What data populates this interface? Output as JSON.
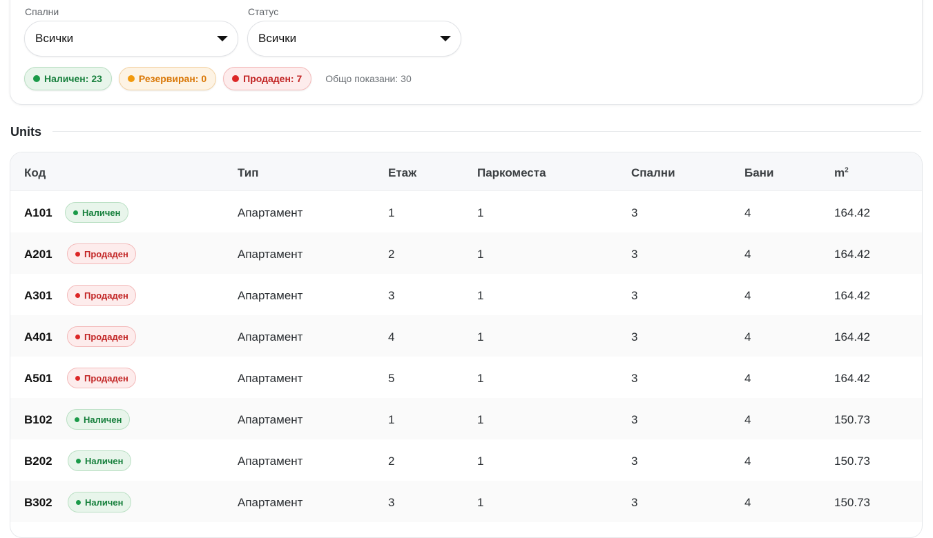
{
  "filters": {
    "bedrooms": {
      "label": "Спални",
      "value": "Всички"
    },
    "status": {
      "label": "Статус",
      "value": "Всички"
    }
  },
  "summary": {
    "available": "Наличен: 23",
    "reserved": "Резервиран: 0",
    "sold": "Продаден: 7",
    "total": "Общо показани: 30"
  },
  "section": {
    "title": "Units"
  },
  "table": {
    "headers": {
      "code": "Код",
      "type": "Тип",
      "floor": "Етаж",
      "parking": "Паркоместа",
      "bedrooms": "Спални",
      "bathrooms": "Бани",
      "area": "m",
      "area_sup": "2"
    },
    "rows": [
      {
        "code": "A101",
        "status": "Наличен",
        "type": "Апартамент",
        "floor": "1",
        "parking": "1",
        "bedrooms": "3",
        "bathrooms": "4",
        "area": "164.42"
      },
      {
        "code": "A201",
        "status": "Продаден",
        "type": "Апартамент",
        "floor": "2",
        "parking": "1",
        "bedrooms": "3",
        "bathrooms": "4",
        "area": "164.42"
      },
      {
        "code": "A301",
        "status": "Продаден",
        "type": "Апартамент",
        "floor": "3",
        "parking": "1",
        "bedrooms": "3",
        "bathrooms": "4",
        "area": "164.42"
      },
      {
        "code": "A401",
        "status": "Продаден",
        "type": "Апартамент",
        "floor": "4",
        "parking": "1",
        "bedrooms": "3",
        "bathrooms": "4",
        "area": "164.42"
      },
      {
        "code": "A501",
        "status": "Продаден",
        "type": "Апартамент",
        "floor": "5",
        "parking": "1",
        "bedrooms": "3",
        "bathrooms": "4",
        "area": "164.42"
      },
      {
        "code": "B102",
        "status": "Наличен",
        "type": "Апартамент",
        "floor": "1",
        "parking": "1",
        "bedrooms": "3",
        "bathrooms": "4",
        "area": "150.73"
      },
      {
        "code": "B202",
        "status": "Наличен",
        "type": "Апартамент",
        "floor": "2",
        "parking": "1",
        "bedrooms": "3",
        "bathrooms": "4",
        "area": "150.73"
      },
      {
        "code": "B302",
        "status": "Наличен",
        "type": "Апартамент",
        "floor": "3",
        "parking": "1",
        "bedrooms": "3",
        "bathrooms": "4",
        "area": "150.73"
      }
    ]
  },
  "colors": {
    "available": "#1a9a48",
    "reserved": "#f29a0e",
    "sold": "#dc2626"
  }
}
